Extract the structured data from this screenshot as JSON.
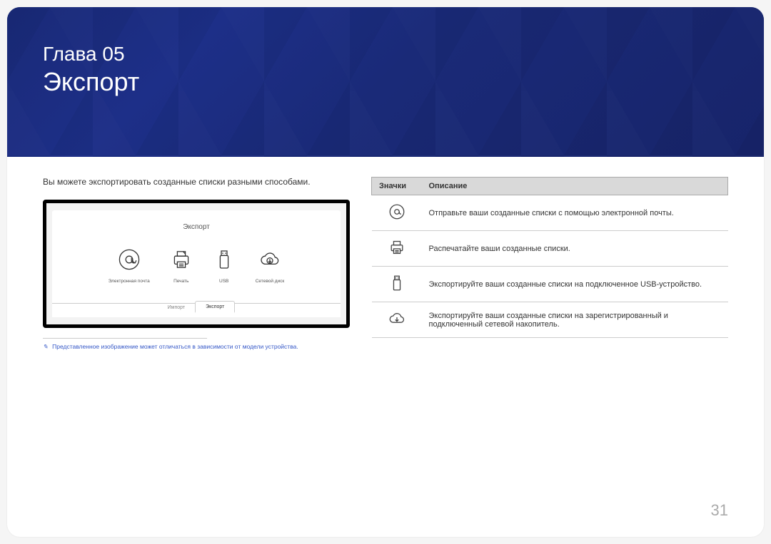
{
  "banner": {
    "chapter": "Глава 05",
    "title": "Экспорт"
  },
  "intro": "Вы можете экспортировать созданные списки разными способами.",
  "screen": {
    "title": "Экспорт",
    "options": [
      {
        "label": "Электронная почта"
      },
      {
        "label": "Печать"
      },
      {
        "label": "USB"
      },
      {
        "label": "Сетевой диск"
      }
    ],
    "tabs": {
      "import": "Импорт",
      "export": "Экспорт"
    }
  },
  "footnote": "Представленное изображение может отличаться в зависимости от модели устройства.",
  "table": {
    "headers": {
      "icons": "Значки",
      "desc": "Описание"
    },
    "rows": [
      {
        "desc": "Отправьте ваши созданные списки с помощью электронной почты."
      },
      {
        "desc": "Распечатайте ваши созданные списки."
      },
      {
        "desc": "Экспортируйте ваши созданные списки на подключенное USB-устройство."
      },
      {
        "desc": "Экспортируйте ваши созданные списки на зарегистрированный и подключенный сетевой накопитель."
      }
    ]
  },
  "page_number": "31"
}
